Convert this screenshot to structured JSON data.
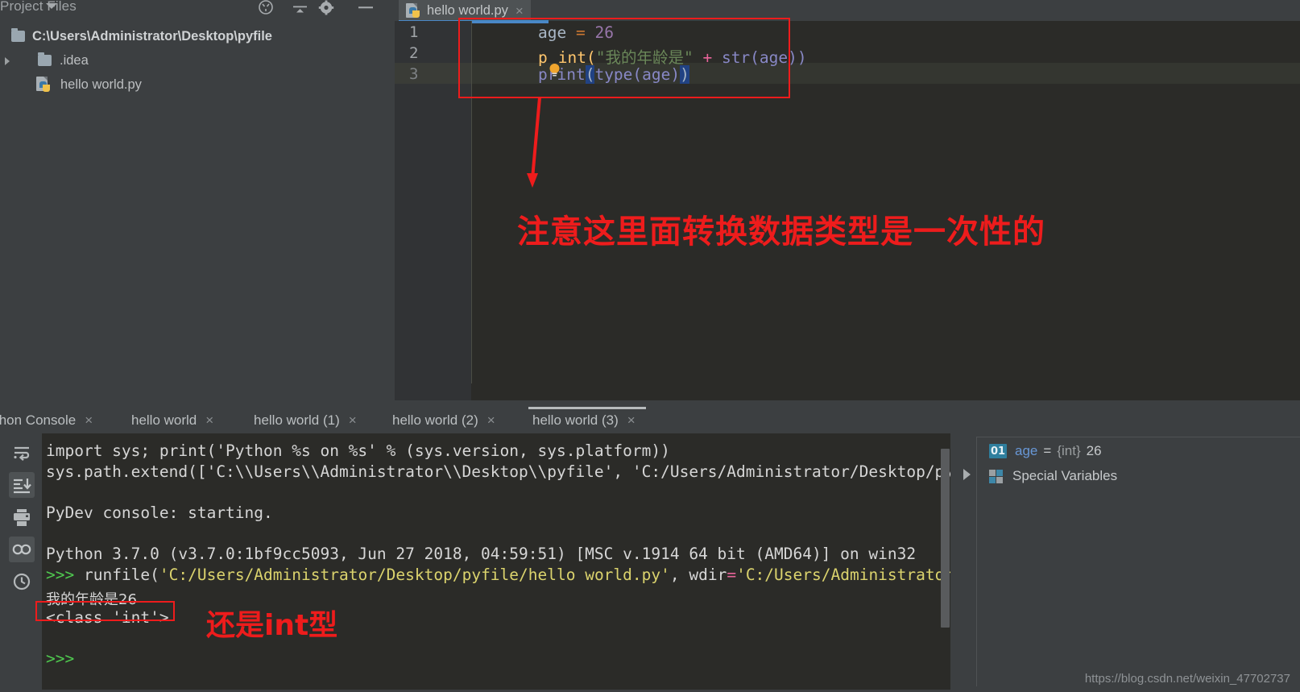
{
  "app": {
    "theme_bg": "#3c3f41",
    "editor_bg": "#2b2b28",
    "accent": "#4a88c7",
    "annotation_color": "#ee1c1c"
  },
  "project_panel": {
    "title": "Project Files",
    "icons": [
      {
        "name": "locate-target-icon"
      },
      {
        "name": "collapse-all-icon"
      },
      {
        "name": "settings-gear-icon"
      },
      {
        "name": "minimize-icon"
      }
    ],
    "tree": [
      {
        "label": "C:\\Users\\Administrator\\Desktop\\pyfile",
        "kind": "root-folder"
      },
      {
        "label": ".idea",
        "kind": "folder"
      },
      {
        "label": "hello world.py",
        "kind": "python-file"
      }
    ]
  },
  "editor": {
    "tab": {
      "label": "hello world.py",
      "close": "×"
    },
    "line_numbers": [
      "1",
      "2",
      "3"
    ],
    "code": {
      "line1": {
        "name": "age",
        "op": "=",
        "value": "26"
      },
      "line2_pre": "p",
      "line2_post": "int(",
      "line2_str": "\"我的年龄是\"",
      "line2_plus": "+",
      "line2_tail": "str(age))",
      "line3_a": "print",
      "line3_b": "(",
      "line3_c": "type(age)",
      "line3_d": ")"
    }
  },
  "annotations": {
    "editor_note": "注意这里面转换数据类型是一次性的",
    "console_note": "还是int型"
  },
  "console": {
    "tabs": [
      {
        "label": "thon Console",
        "active": false,
        "close": "×"
      },
      {
        "label": "hello world",
        "active": false,
        "close": "×"
      },
      {
        "label": "hello world (1)",
        "active": false,
        "close": "×"
      },
      {
        "label": "hello world (2)",
        "active": false,
        "close": "×"
      },
      {
        "label": "hello world (3)",
        "active": true,
        "close": "×"
      }
    ],
    "toolbar_icons": [
      {
        "name": "soft-wrap-icon",
        "active": false
      },
      {
        "name": "scroll-to-end-icon",
        "active": true
      },
      {
        "name": "print-icon",
        "active": false
      },
      {
        "name": "show-console-variables-icon",
        "active": true
      },
      {
        "name": "command-history-icon",
        "active": false
      }
    ],
    "output": {
      "l1": "import sys; print('Python %s on %s' % (sys.version, sys.platform))",
      "l2": "sys.path.extend(['C:\\\\Users\\\\Administrator\\\\Desktop\\\\pyfile', 'C:/Users/Administrator/Desktop/pyf",
      "l3": "PyDev console: starting.",
      "l4": "Python 3.7.0 (v3.7.0:1bf9cc5093, Jun 27 2018, 04:59:51) [MSC v.1914 64 bit (AMD64)] on win32",
      "l5_prompt": ">>>",
      "l5_cmd_a": " runfile(",
      "l5_path": "'C:/Users/Administrator/Desktop/pyfile/hello world.py'",
      "l5_comma": ", wdir",
      "l5_eq": "=",
      "l5_wdir": "'C:/Users/Administrator/",
      "l6": "我的年龄是26",
      "l7": "<class 'int'>",
      "l8_prompt": ">>>"
    }
  },
  "variables": {
    "rows": [
      {
        "badge": "01",
        "name": "age",
        "eq": "=",
        "type": "{int}",
        "value": "26"
      },
      {
        "label": "Special Variables"
      }
    ]
  },
  "watermark": "https://blog.csdn.net/weixin_47702737"
}
